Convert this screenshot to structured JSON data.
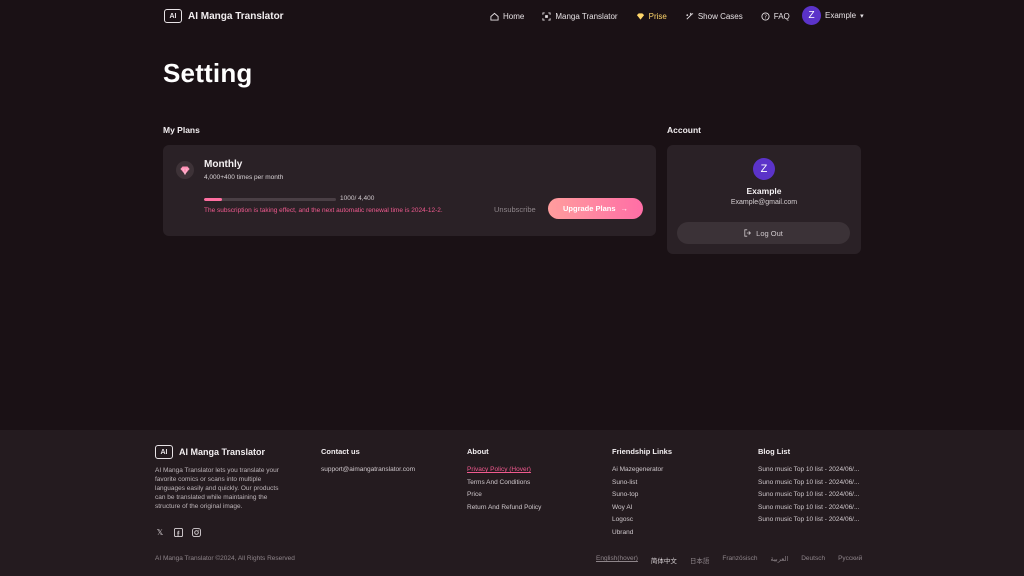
{
  "brand": {
    "name": "AI Manga Translator",
    "mark": "AI"
  },
  "nav": {
    "home": "Home",
    "manga_translator": "Manga Translator",
    "prise": "Prise",
    "show_cases": "Show Cases",
    "faq": "FAQ"
  },
  "user": {
    "initial": "Z",
    "name": "Example",
    "email": "Example@gmail.com"
  },
  "page": {
    "title": "Setting"
  },
  "plans": {
    "section_label": "My Plans",
    "name": "Monthly",
    "quota": "4,000+400 times per month",
    "usage_text": "1000/ 4,400",
    "usage_fraction": 0.1364,
    "renewal_note": "The subscription is taking effect, and the next automatic renewal time is 2024-12-2.",
    "unsubscribe": "Unsubscribe",
    "upgrade": "Upgrade Plans"
  },
  "account": {
    "section_label": "Account",
    "logout": "Log Out"
  },
  "footer": {
    "brand": "AI Manga Translator",
    "description": "AI Manga Translator lets you translate your favorite comics or scans into multiple languages easily and quickly. Our products can be translated while maintaining the structure of the original image.",
    "copyright": "AI Manga Translator ©2024, All Rights Reserved",
    "contact": {
      "title": "Contact us",
      "email": "support@aimangatranslator.com"
    },
    "about": {
      "title": "About",
      "links": [
        "Privacy Policy (Hover)",
        "Terms And Conditions",
        "Price",
        "Return And Refund Policy"
      ]
    },
    "friendship": {
      "title": "Friendship Links",
      "links": [
        "Ai Mazegenerator",
        "Suno-list",
        "Suno-top",
        "Woy AI",
        "Logosc",
        "Ubrand"
      ]
    },
    "blog": {
      "title": "Blog List",
      "links": [
        "Suno music Top 10 list - 2024/06/...",
        "Suno music Top 10 list - 2024/06/...",
        "Suno music Top 10 list - 2024/06/...",
        "Suno music Top 10 list - 2024/06/...",
        "Suno music Top 10 list - 2024/06/..."
      ]
    },
    "languages": [
      "English(hover)",
      "简体中文",
      "日本語",
      "Französisch",
      "العربية",
      "Deutsch",
      "Русский"
    ]
  },
  "colors": {
    "accent_pink": "#ff6fa1",
    "prise_yellow": "#ffd66a",
    "avatar_purple": "#5b33c9",
    "bg": "#1a1115",
    "card": "#2a2126"
  }
}
